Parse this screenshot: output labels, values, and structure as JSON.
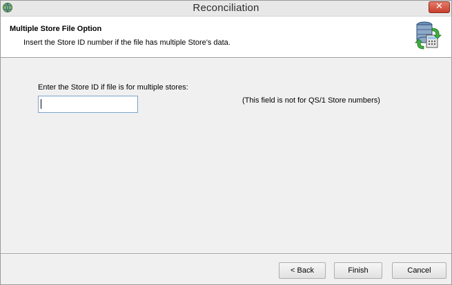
{
  "window": {
    "title": "Reconciliation",
    "close_glyph": "✕"
  },
  "header": {
    "title": "Multiple Store File Option",
    "subtitle": "Insert the Store ID number if the file has multiple Store's data.",
    "icon": "database-sync-icon"
  },
  "form": {
    "prompt_label": "Enter the Store ID if file is for multiple stores:",
    "store_id_value": "",
    "note": "(This field is not for QS/1 Store numbers)"
  },
  "buttons": {
    "back": "< Back",
    "finish": "Finish",
    "cancel": "Cancel"
  },
  "colors": {
    "close_button": "#c7402d",
    "input_border": "#7aa3c9"
  }
}
